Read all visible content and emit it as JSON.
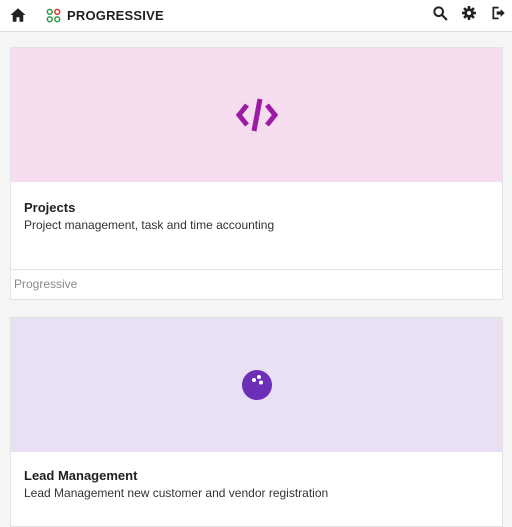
{
  "header": {
    "title": "PROGRESSIVE",
    "icons": {
      "home": "home-icon",
      "logo": "app-logo-icon",
      "search": "search-icon",
      "settings": "gear-icon",
      "logout": "logout-icon"
    }
  },
  "apps": [
    {
      "title": "Projects",
      "description": "Project management, task and time accounting",
      "footer": "Progressive",
      "icon": "code-icon",
      "hero_color": "#f6dcef",
      "icon_color": "#9c1aa4"
    },
    {
      "title": "Lead Management",
      "description": "Lead Management new customer and vendor registration",
      "icon": "bowling-ball-icon",
      "hero_color": "#e9e0f3",
      "icon_color": "#6c2fb8"
    }
  ],
  "colors": {
    "logo_green": "#2e9e4a",
    "logo_red": "#d9342b"
  }
}
